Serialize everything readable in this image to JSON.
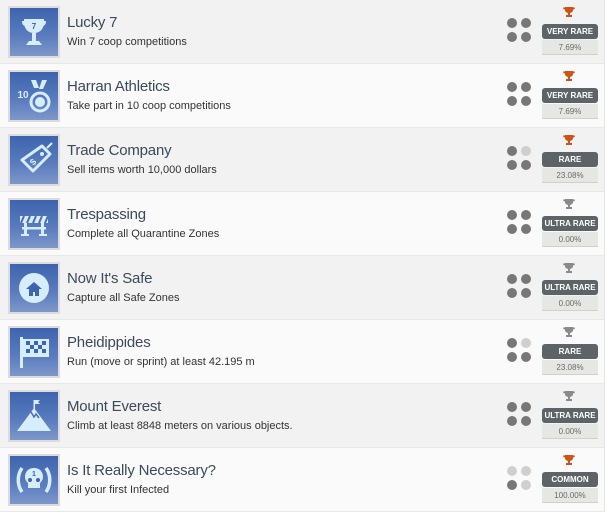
{
  "colors": {
    "earned_trophy": "#d1531a",
    "unearned_trophy": "#8a8a8a",
    "icon_bg": "#4a6db4",
    "badge_bg": "#5d6468"
  },
  "achievements": [
    {
      "title": "Lucky 7",
      "description": "Win 7 coop competitions",
      "icon": "trophy-cup-7-icon",
      "rarity": "VERY RARE",
      "percent": "7.69%",
      "earned": true,
      "dots": [
        true,
        true,
        true,
        true
      ]
    },
    {
      "title": "Harran Athletics",
      "description": "Take part in 10 coop competitions",
      "icon": "medal-10-icon",
      "rarity": "VERY RARE",
      "percent": "7.69%",
      "earned": true,
      "dots": [
        true,
        true,
        true,
        true
      ]
    },
    {
      "title": "Trade Company",
      "description": "Sell items worth 10,000 dollars",
      "icon": "price-tag-icon",
      "rarity": "RARE",
      "percent": "23.08%",
      "earned": true,
      "dots": [
        true,
        false,
        true,
        true
      ]
    },
    {
      "title": "Trespassing",
      "description": "Complete all Quarantine Zones",
      "icon": "barrier-icon",
      "rarity": "ULTRA RARE",
      "percent": "0.00%",
      "earned": false,
      "dots": [
        true,
        true,
        true,
        true
      ]
    },
    {
      "title": "Now It's Safe",
      "description": "Capture all Safe Zones",
      "icon": "house-icon",
      "rarity": "ULTRA RARE",
      "percent": "0.00%",
      "earned": false,
      "dots": [
        true,
        true,
        true,
        true
      ]
    },
    {
      "title": "Pheidippides",
      "description": "Run (move or sprint) at least 42.195 m",
      "icon": "checkered-flag-icon",
      "rarity": "RARE",
      "percent": "23.08%",
      "earned": false,
      "dots": [
        true,
        false,
        true,
        true
      ]
    },
    {
      "title": "Mount Everest",
      "description": "Climb at least 8848 meters on various objects.",
      "icon": "mountain-flag-icon",
      "rarity": "ULTRA RARE",
      "percent": "0.00%",
      "earned": false,
      "dots": [
        true,
        true,
        true,
        true
      ]
    },
    {
      "title": "Is It Really Necessary?",
      "description": "Kill your first Infected",
      "icon": "skull-icon",
      "rarity": "COMMON",
      "percent": "100.00%",
      "earned": true,
      "dots": [
        false,
        false,
        true,
        false
      ]
    }
  ]
}
